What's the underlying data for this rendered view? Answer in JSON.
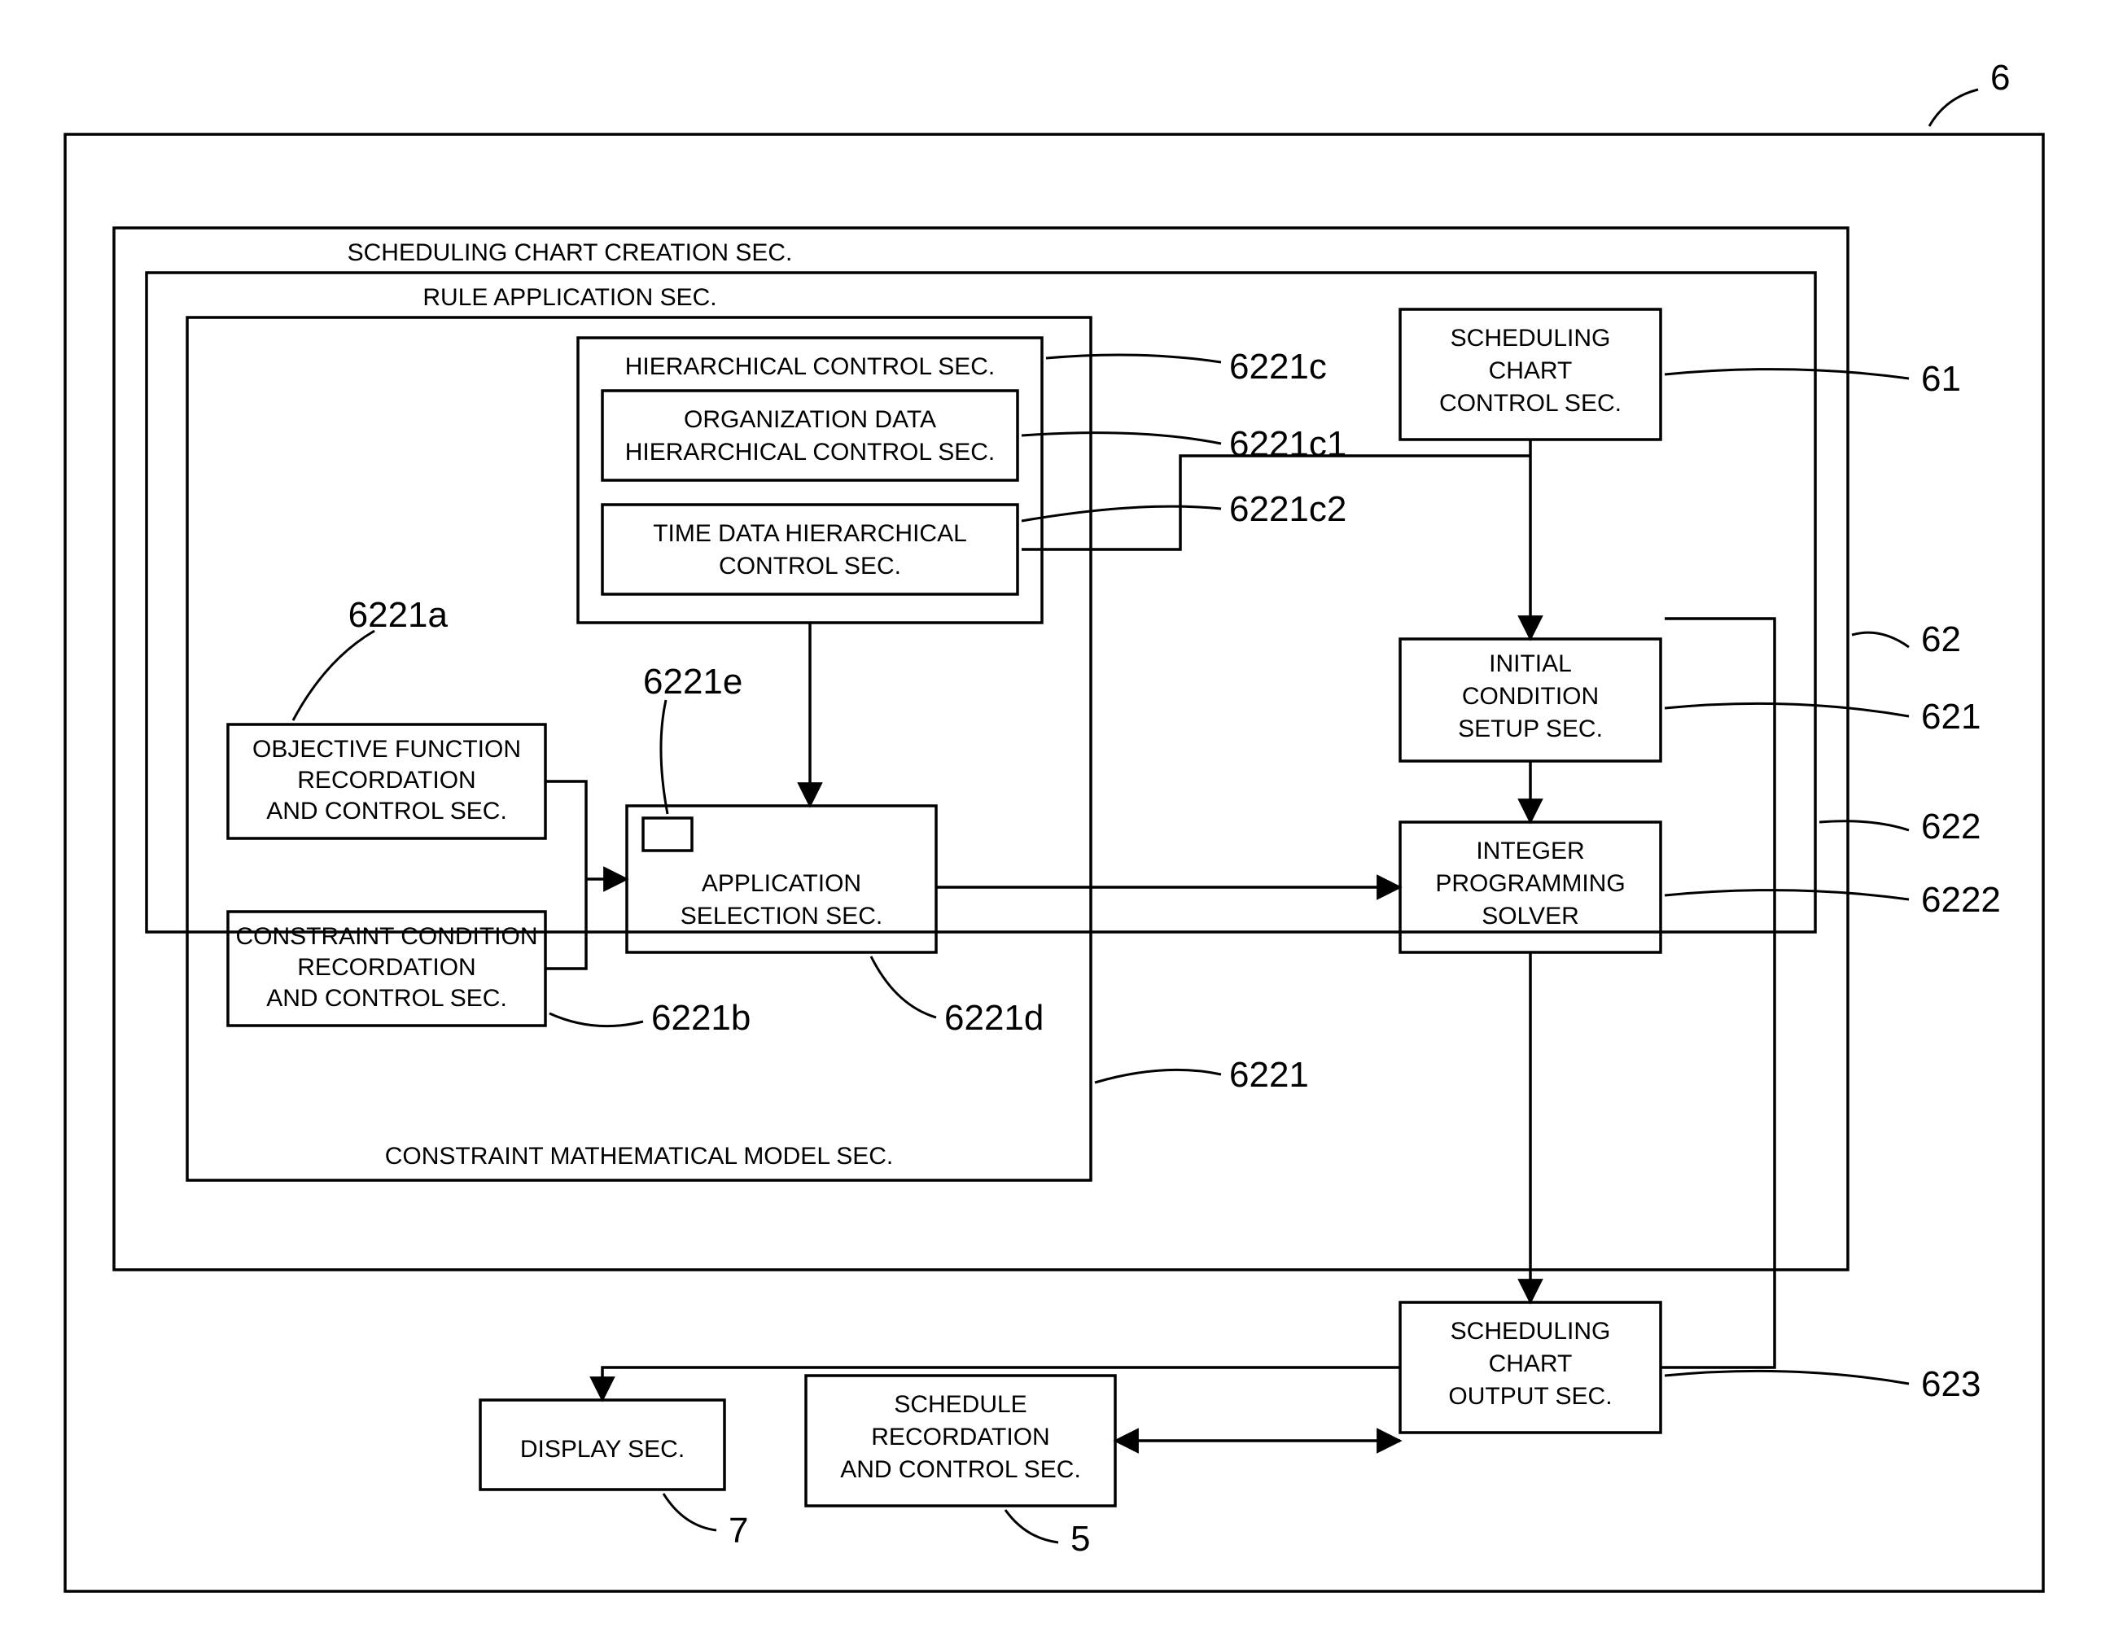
{
  "refs": {
    "r6": "6",
    "r61": "61",
    "r62": "62",
    "r621": "621",
    "r622": "622",
    "r6221": "6221",
    "r6222": "6222",
    "r623": "623",
    "r6221a": "6221a",
    "r6221b": "6221b",
    "r6221c": "6221c",
    "r6221c1": "6221c1",
    "r6221c2": "6221c2",
    "r6221d": "6221d",
    "r6221e": "6221e",
    "r7": "7",
    "r5": "5"
  },
  "labels": {
    "scc_sec_title": "SCHEDULING CHART CREATION SEC.",
    "rule_app_sec_title": "RULE APPLICATION SEC.",
    "cmm_sec_title": "CONSTRAINT MATHEMATICAL MODEL SEC.",
    "hier_ctrl_sec": "HIERARCHICAL CONTROL SEC.",
    "org_data_l1": "ORGANIZATION DATA",
    "org_data_l2": "HIERARCHICAL CONTROL SEC.",
    "time_data_l1": "TIME DATA HIERARCHICAL",
    "time_data_l2": "CONTROL SEC.",
    "obj_l1": "OBJECTIVE FUNCTION",
    "obj_l2": "RECORDATION",
    "obj_l3": "AND CONTROL SEC.",
    "cc_l1": "CONSTRAINT CONDITION",
    "cc_l2": "RECORDATION",
    "cc_l3": "AND CONTROL SEC.",
    "appsel_l1": "APPLICATION",
    "appsel_l2": "SELECTION SEC.",
    "sched_ctrl_l1": "SCHEDULING",
    "sched_ctrl_l2": "CHART",
    "sched_ctrl_l3": "CONTROL SEC.",
    "init_l1": "INITIAL",
    "init_l2": "CONDITION",
    "init_l3": "SETUP SEC.",
    "solver_l1": "INTEGER",
    "solver_l2": "PROGRAMMING",
    "solver_l3": "SOLVER",
    "out_l1": "SCHEDULING",
    "out_l2": "CHART",
    "out_l3": "OUTPUT SEC.",
    "display": "DISPLAY SEC.",
    "sr_l1": "SCHEDULE",
    "sr_l2": "RECORDATION",
    "sr_l3": "AND CONTROL SEC."
  }
}
